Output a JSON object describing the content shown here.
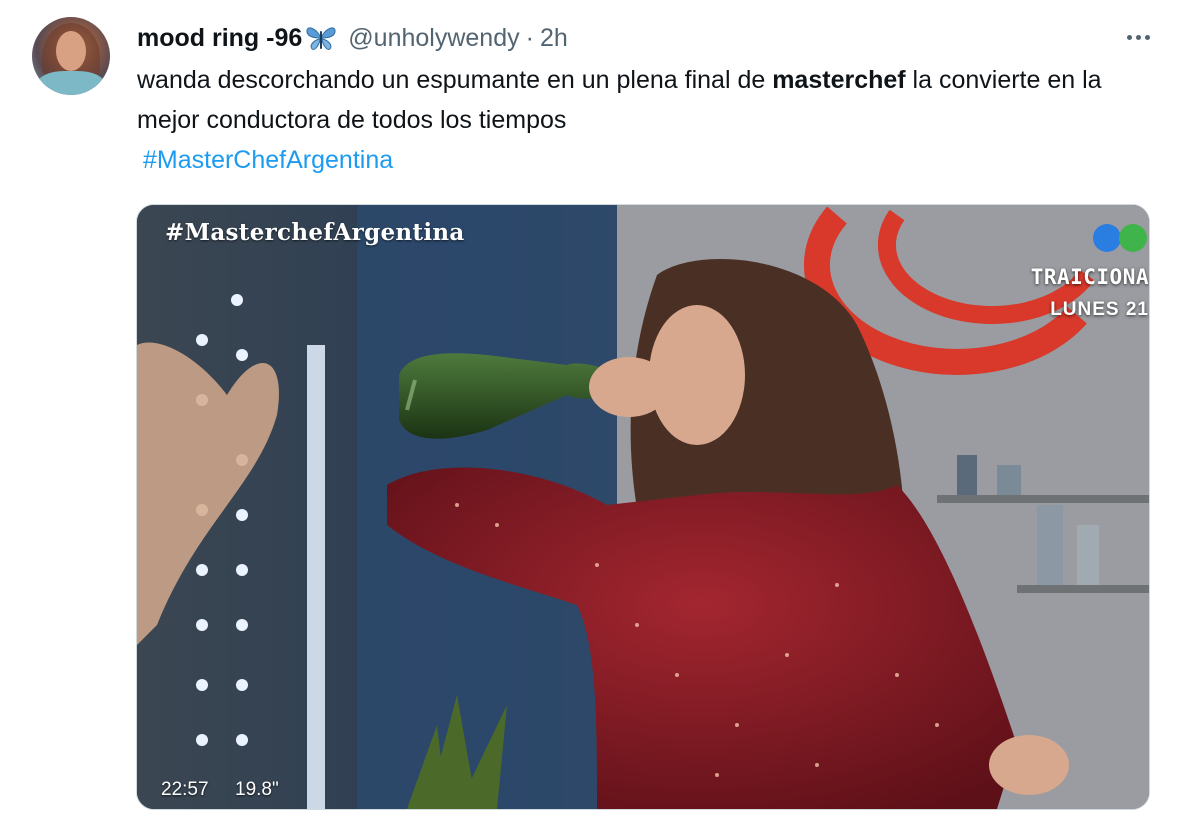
{
  "author": {
    "display_name": "mood ring -96",
    "badge_icon": "butterfly-icon",
    "handle": "@unholywendy",
    "separator": "·",
    "time": "2h"
  },
  "tweet": {
    "text_before": "wanda descorchando un espumante en un plena final de ",
    "text_bold": "masterchef",
    "text_after": " la convierte en la mejor conductora de todos los tiempos",
    "hashtag": "#MasterChefArgentina"
  },
  "media": {
    "overlay_tag": "#MasterchefArgentina",
    "promo_line1": "TRAICIONA",
    "promo_line2": "LUNES 21",
    "clock": "22:57",
    "temperature": "19.8\""
  },
  "colors": {
    "link": "#1d9bf0",
    "secondary_text": "#536471",
    "primary_text": "#0f1419"
  }
}
